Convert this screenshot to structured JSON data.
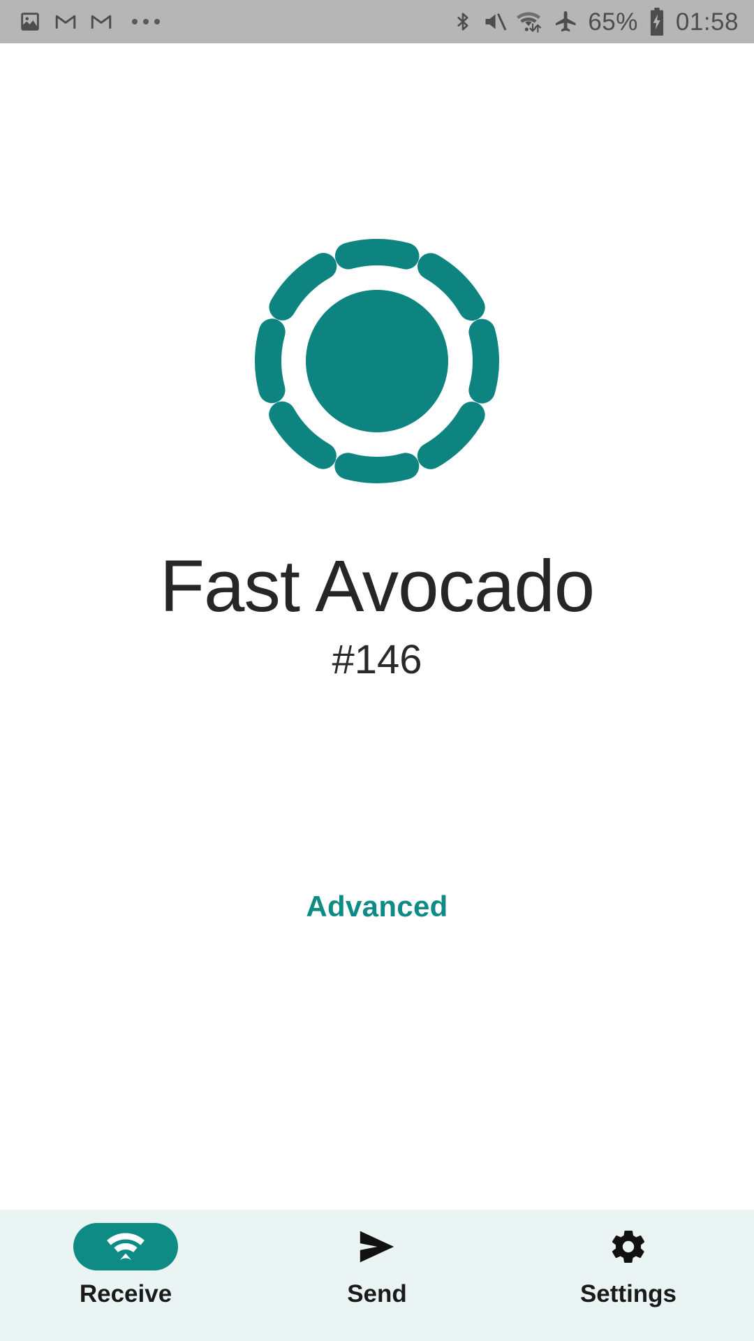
{
  "status_bar": {
    "left_icons": [
      {
        "name": "image-icon",
        "label": "image"
      },
      {
        "name": "gmail-icon",
        "label": "gmail"
      },
      {
        "name": "gmail-icon-2",
        "label": "gmail"
      },
      {
        "name": "more-notifications-icon",
        "label": "more"
      }
    ],
    "right_icons": [
      {
        "name": "bluetooth-icon",
        "label": "bluetooth"
      },
      {
        "name": "volume-mute-icon",
        "label": "muted"
      },
      {
        "name": "wifi-data-icon",
        "label": "wifi"
      },
      {
        "name": "airplane-mode-icon",
        "label": "airplane mode"
      }
    ],
    "battery_percent": "65%",
    "battery_state": "charging",
    "time": "01:58",
    "background_color": "#b6b6b6",
    "foreground_color": "#4d4d4d"
  },
  "main": {
    "logo": {
      "name": "dotted-ring-logo",
      "color": "#0e8481",
      "segments": 8
    },
    "device_name": "Fast Avocado",
    "device_code": "#146",
    "advanced_label": "Advanced",
    "advanced_color": "#0e8b84"
  },
  "bottom_nav": {
    "background_color": "#eaf4f2",
    "active_color": "#0e8b84",
    "items": [
      {
        "label": "Receive",
        "icon": "wifi-icon",
        "active": true
      },
      {
        "label": "Send",
        "icon": "send-icon",
        "active": false
      },
      {
        "label": "Settings",
        "icon": "gear-icon",
        "active": false
      }
    ]
  }
}
